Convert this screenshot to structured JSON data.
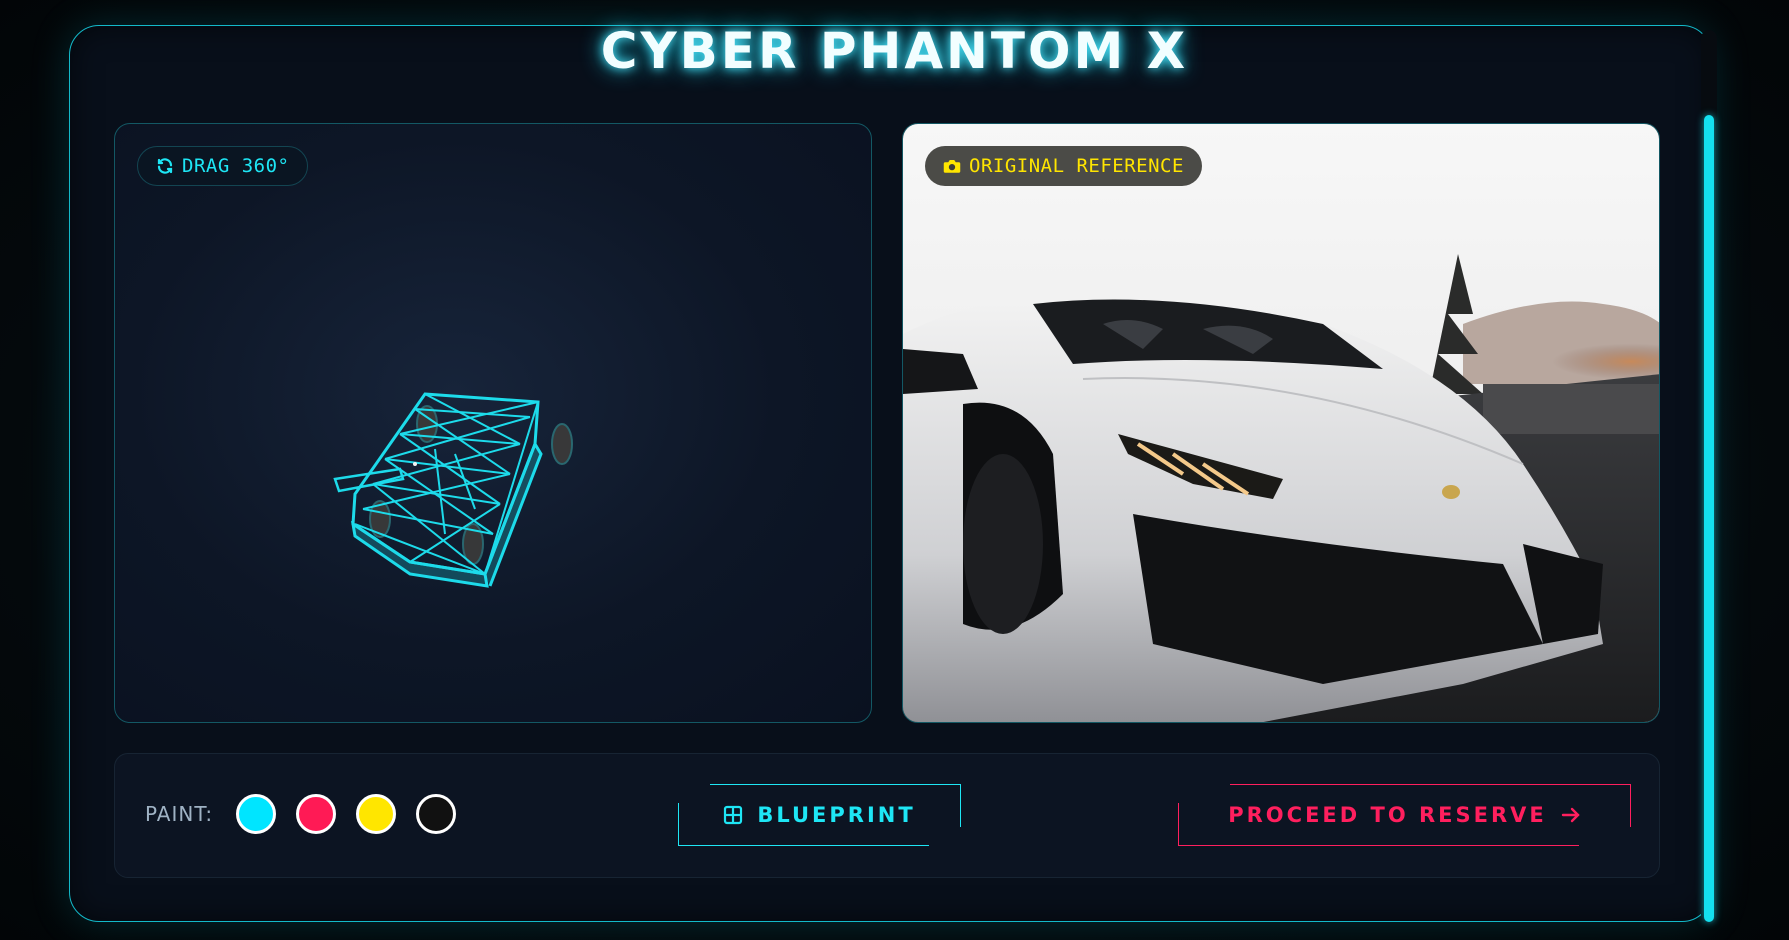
{
  "app": {
    "title": "CYBER PHANTOM X"
  },
  "viewer": {
    "badge_label": "DRAG 360°",
    "badge_icon": "rotate-icon",
    "model_color": "#1ee6f5"
  },
  "reference": {
    "badge_label": "ORIGINAL REFERENCE",
    "badge_icon": "camera-icon"
  },
  "controls": {
    "paint_label": "PAINT:",
    "swatches": [
      {
        "name": "cyan",
        "color": "#00e5ff"
      },
      {
        "name": "magenta",
        "color": "#ff1a55"
      },
      {
        "name": "yellow",
        "color": "#ffe600"
      },
      {
        "name": "black",
        "color": "#111111"
      }
    ],
    "blueprint_label": "BLUEPRINT",
    "blueprint_icon": "grid-icon",
    "reserve_label": "PROCEED TO RESERVE",
    "reserve_icon": "arrow-right-icon"
  },
  "colors": {
    "accent": "#1ee6f5",
    "danger": "#ff1f5e",
    "highlight": "#ffe500"
  }
}
